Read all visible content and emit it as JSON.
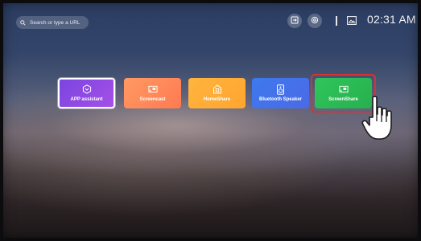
{
  "search": {
    "placeholder": "Search or type a URL"
  },
  "status": {
    "time": "02:31 AM"
  },
  "icons": {
    "search": "search-icon",
    "input_source": "input-source-icon",
    "settings": "settings-icon",
    "image": "image-icon",
    "pointer": "pointing-hand-icon"
  },
  "apps": [
    {
      "label": "APP assistant",
      "icon": "hexagon-check-icon",
      "color": "#8a4be3"
    },
    {
      "label": "Screencast",
      "icon": "cast-icon",
      "color": "#ff8a5a"
    },
    {
      "label": "HomeShare",
      "icon": "home-share-icon",
      "color": "#ffad38"
    },
    {
      "label": "Bluetooth Speaker",
      "icon": "speaker-icon",
      "color": "#4472ea"
    },
    {
      "label": "ScreenShare",
      "icon": "screen-share-icon",
      "color": "#2cbf56"
    }
  ],
  "accent": {
    "highlight": "#d93232",
    "selection": "#ffffff"
  }
}
